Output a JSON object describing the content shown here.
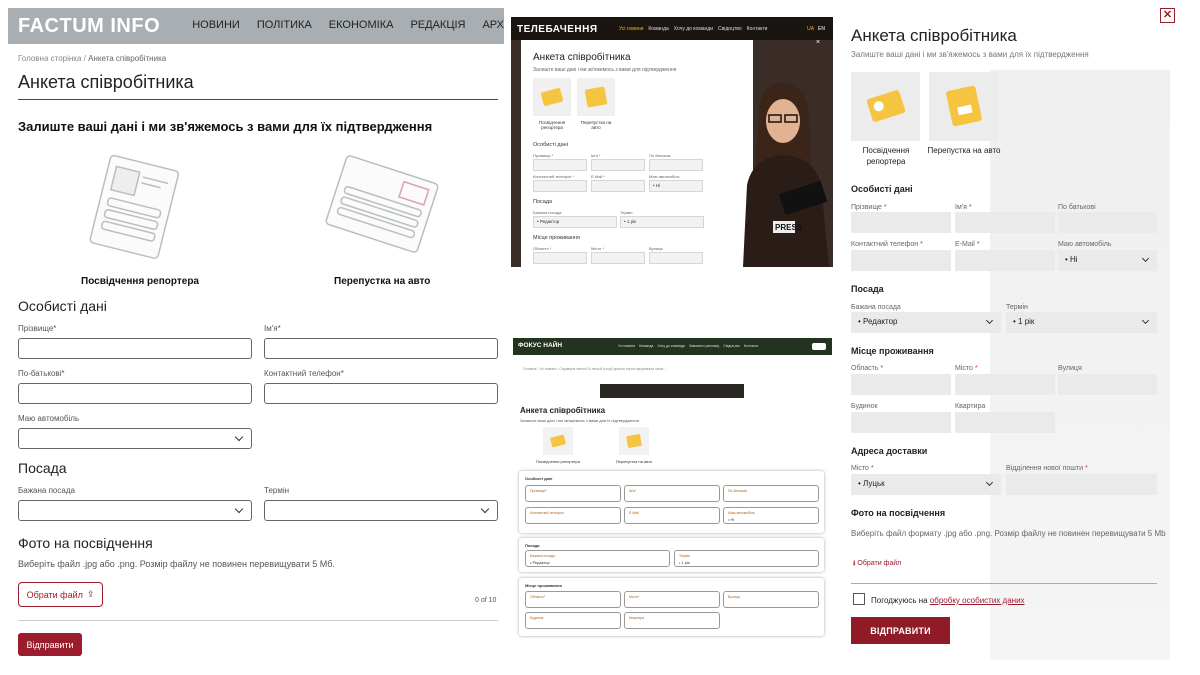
{
  "panel1": {
    "logo": "FACTUM INFO",
    "nav": [
      "НОВИНИ",
      "ПОЛІТИКА",
      "ЕКОНОМІКА",
      "РЕДАКЦІЯ",
      "АРХ"
    ],
    "breadcrumb_home": "Головна сторінка",
    "breadcrumb_sep": "/",
    "breadcrumb_current": "Анкета співробітника",
    "title": "Анкета співробітника",
    "subtitle": "Залиште ваші дані і ми зв'яжемось з вами для їх підтвердження",
    "card1_label": "Посвідчення репортера",
    "card2_label": "Перепустка на авто",
    "section_personal": "Особисті дані",
    "lbl_surname": "Прізвище*",
    "lbl_name": "Ім'я*",
    "lbl_patronymic": "По-батькові*",
    "lbl_phone": "Контактний телефон*",
    "lbl_car": "Маю автомобіль",
    "section_position": "Посада",
    "lbl_position": "Бажана посада",
    "lbl_term": "Термін",
    "section_photo": "Фото на посвідчення",
    "photo_hint": "Виберіть файл .jpg або .png. Розмір файлу не повинен перевищувати 5 Мб.",
    "upload_label": "Обрати файл",
    "counter": "0 of 10",
    "submit_label": "Відправити"
  },
  "panel2": {
    "logo": "ТЕЛЕБАЧЕННЯ",
    "nav": [
      "Усі новини",
      "Команда",
      "Хочу до команди",
      "Свідоцтво",
      "Контакти"
    ],
    "lang": [
      "UA",
      "EN"
    ],
    "modal_title": "Анкета співробітника",
    "modal_sub": "Залиште ваші дані і ми зв'яжемось з вами для підтвердження",
    "card1": "Посвідчення репортера",
    "card2": "Перепустка на авто",
    "sec_personal": "Особисті дані",
    "lbl_surname": "Прізвище *",
    "lbl_name": "Ім'я *",
    "lbl_patronymic": "По батькові",
    "lbl_phone": "Контактний телефон *",
    "lbl_email": "E-Mail *",
    "lbl_car": "Маю автомобіль",
    "val_car": "• Ні",
    "sec_position": "Посада",
    "lbl_position": "Бажана посада",
    "val_position": "• Редактор",
    "lbl_term": "Термін",
    "val_term": "• 1 рік",
    "sec_address": "Місце проживання",
    "lbl_region": "Область *",
    "lbl_city": "Місто *",
    "lbl_street": "Вулиця",
    "badge": "PRESS",
    "close": "×"
  },
  "panel3": {
    "logo": "ФОКУС НАЙН",
    "nav": [
      "Усі новини",
      "Команда",
      "Хочу до команди",
      "Замовити рекламу",
      "Свідоцтво",
      "Контакти"
    ],
    "breadcrumb": "Головна  /  Усі новини  /  Справжнє світло! В ліпшій історії донька героя підтримала свою ...",
    "title": "Анкета співробітника",
    "sub": "Залиште ваші дані і ми зв'яжемось з вами для їх підтвердження",
    "card1": "Посвідчення репортера",
    "card2": "Перепустка на авто",
    "box1_title": "Особисті дані",
    "f_surname": "Прізвище*",
    "f_name": "Ім'я*",
    "f_patronymic": "По-батькові",
    "f_phone": "Контактний телефон",
    "f_email": "E-Mail",
    "f_car": "Маю автомобіль",
    "f_car_val": "• Ні",
    "box2_title": "Посада",
    "f_position": "Бажана посада",
    "f_position_val": "• Редактор",
    "f_term": "Термін",
    "f_term_val": "• 1 рік",
    "box3_title": "Місце проживання",
    "f_region": "Область*",
    "f_city": "Місто*",
    "f_street": "Вулиця",
    "f_house": "Будинок",
    "f_flat": "Квартира"
  },
  "panel4": {
    "close": "✕",
    "title": "Анкета співробітника",
    "sub": "Залиште ваші дані і ми зв'яжемось з вами для їх підтвердження",
    "card1": "Посвідчення репортера",
    "card2": "Перепустка на авто",
    "sec_personal": "Особисті дані",
    "lbl_surname": "Прізвище",
    "lbl_name": "Ім'я",
    "lbl_patronymic": "По батькові",
    "lbl_phone": "Контактний телефон",
    "lbl_email": "E-Mail",
    "lbl_car": "Маю автомобіль",
    "val_car": "• Ні",
    "sec_position": "Посада",
    "lbl_position": "Бажана посада",
    "val_position": "• Редактор",
    "lbl_term": "Термін",
    "val_term": "• 1 рік",
    "sec_address": "Місце проживання",
    "lbl_region": "Область",
    "lbl_city": "Місто",
    "lbl_street": "Вулиця",
    "lbl_house": "Будинок",
    "lbl_flat": "Квартира",
    "sec_delivery": "Адреса доставки",
    "lbl_dcity": "Місто",
    "val_dcity": "• Луцьк",
    "lbl_np": "Відділення нової пошти",
    "sec_photo": "Фото на посвідчення",
    "photo_hint": "Виберіть файл формату .jpg або .png. Розмір файлу не повинен перевищувати 5 Mb",
    "upload": "Обрати файл",
    "agree_text": "Погоджуюсь на ",
    "agree_link": "обробку особистих даних",
    "submit": "ВІДПРАВИТИ",
    "req": "*"
  },
  "colors": {
    "brand": "#9b1d2d",
    "header_gray": "#a9aeb2",
    "dark_header": "#1b1512",
    "green_header": "#233320"
  }
}
